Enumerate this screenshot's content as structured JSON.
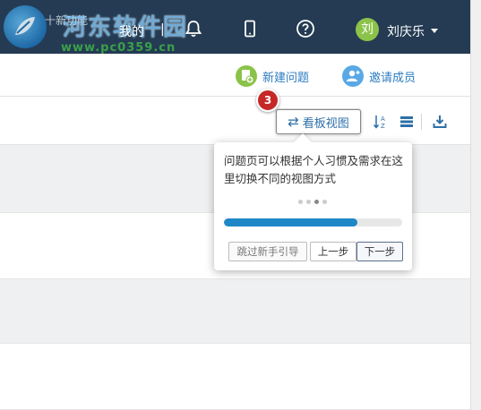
{
  "nav": {
    "logo_text": "十新功能",
    "mine": "我的",
    "separator": "|",
    "avatar_char": "刘",
    "username": "刘庆乐"
  },
  "watermark": {
    "line1": "河东软件园",
    "line2": "www.pc0359.cn"
  },
  "actions": {
    "new_issue": "新建问题",
    "invite_member": "邀请成员"
  },
  "toolbar": {
    "kanban_view": "看板视图",
    "sort_icon": "sort-az-icon",
    "list_icon": "list-icon",
    "download_icon": "download-icon"
  },
  "guide": {
    "step_number": "3",
    "message": "问题页可以根据个人习惯及需求在这里切换不同的视图方式",
    "progress_fraction": 0.75,
    "dots_total": 4,
    "dot_active_index": 2,
    "skip_label": "跳过新手引导",
    "prev_label": "上一步",
    "next_label": "下一步"
  },
  "colors": {
    "navbar": "#243b53",
    "accent_blue": "#2d7cc1",
    "progress": "#1e88c7",
    "badge_red": "#c62828",
    "avatar_green": "#8bc34a"
  }
}
